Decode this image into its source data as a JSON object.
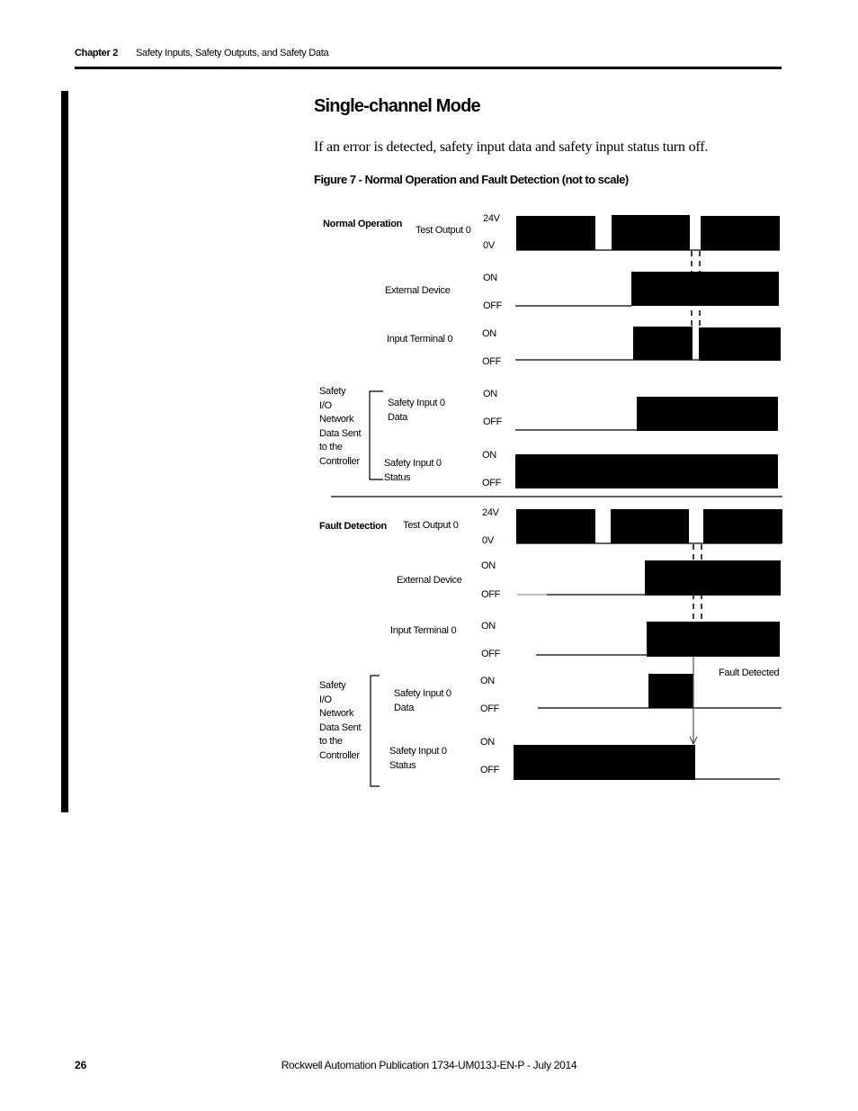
{
  "header": {
    "chapter": "Chapter 2",
    "chapter_title": "Safety Inputs, Safety Outputs, and Safety Data"
  },
  "section": {
    "title": "Single-channel Mode",
    "body": "If an error is detected, safety input data and safety input status turn off."
  },
  "figure": {
    "caption": "Figure 7 - Normal Operation and Fault Detection (not to scale)",
    "normal": {
      "heading": "Normal Operation",
      "group_label": [
        "Safety",
        "I/O",
        "Network",
        "Data Sent",
        "to the",
        "Controller"
      ],
      "signals": [
        {
          "name": "Test Output 0",
          "high": "24V",
          "low": "0V"
        },
        {
          "name": "External Device",
          "high": "ON",
          "low": "OFF"
        },
        {
          "name": "Input Terminal 0",
          "high": "ON",
          "low": "OFF"
        },
        {
          "name": "Safety Input 0 Data",
          "name_lines": [
            "Safety Input 0",
            "Data"
          ],
          "high": "ON",
          "low": "OFF"
        },
        {
          "name": "Safety Input 0 Status",
          "name_lines": [
            "Safety Input 0",
            "Status"
          ],
          "high": "ON",
          "low": "OFF"
        }
      ]
    },
    "fault": {
      "heading": "Fault Detection",
      "annotation": "Fault Detected",
      "group_label": [
        "Safety",
        "I/O",
        "Network",
        "Data Sent",
        "to the",
        "Controller"
      ],
      "signals": [
        {
          "name": "Test Output 0",
          "high": "24V",
          "low": "0V"
        },
        {
          "name": "External Device",
          "high": "ON",
          "low": "OFF"
        },
        {
          "name": "Input Terminal 0",
          "high": "ON",
          "low": "OFF"
        },
        {
          "name": "Safety Input 0 Data",
          "name_lines": [
            "Safety Input 0",
            "Data"
          ],
          "high": "ON",
          "low": "OFF"
        },
        {
          "name": "Safety Input 0 Status",
          "name_lines": [
            "Safety Input 0",
            "Status"
          ],
          "high": "ON",
          "low": "OFF"
        }
      ]
    }
  },
  "footer": {
    "page_number": "26",
    "publication": "Rockwell Automation Publication 1734-UM013J-EN-P - July 2014"
  }
}
